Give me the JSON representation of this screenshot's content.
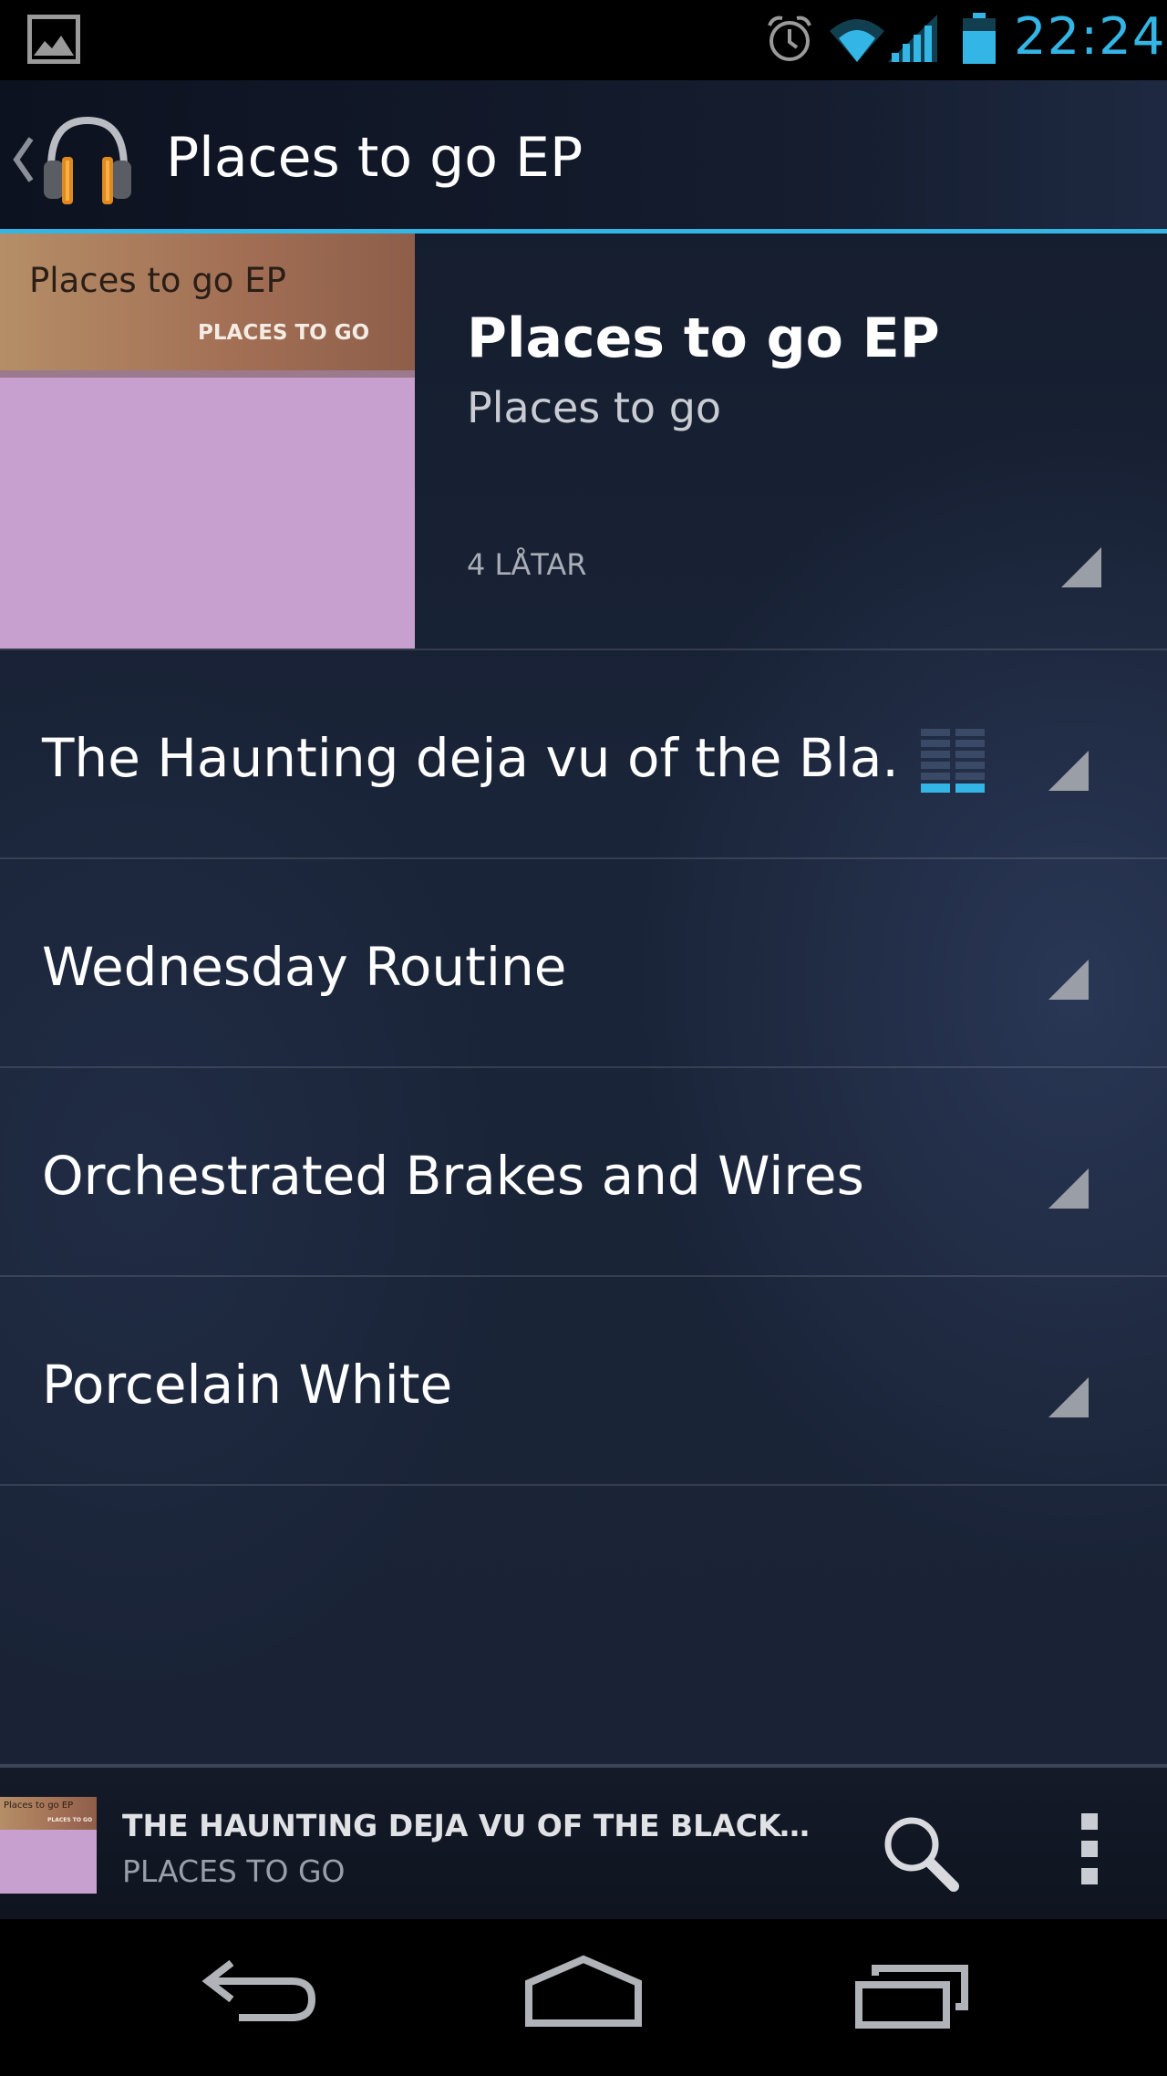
{
  "status_bar": {
    "time": "22:24",
    "icons": [
      "gallery-notification-icon",
      "alarm-icon",
      "wifi-icon",
      "cell-signal-icon",
      "battery-icon"
    ],
    "accent_color": "#33b5e5"
  },
  "action_bar": {
    "title": "Places to go EP",
    "icons": [
      "up-caret-icon",
      "headphones-app-icon"
    ],
    "accent_color": "#33b5e5"
  },
  "album": {
    "title": "Places to go EP",
    "artist": "Places to go",
    "track_count": "4 LÅTAR",
    "art": {
      "title": "Places to go EP",
      "subtitle": "PLACES TO GO",
      "background_color": "#c8a0d0",
      "banner_color": "#a37055"
    }
  },
  "tracks": [
    {
      "title": "The Haunting deja vu of the Bla.",
      "now_playing": true
    },
    {
      "title": "Wednesday Routine",
      "now_playing": false
    },
    {
      "title": "Orchestrated Brakes and Wires",
      "now_playing": false
    },
    {
      "title": "Porcelain White",
      "now_playing": false
    }
  ],
  "now_playing": {
    "title": "THE HAUNTING DEJA VU OF THE BLACKOUTR...",
    "artist": "PLACES TO GO",
    "art_title": "Places to go EP",
    "art_subtitle": "PLACES TO GO",
    "icons": [
      "search-icon",
      "overflow-menu-icon"
    ]
  },
  "nav_bar": {
    "icons": [
      "back-icon",
      "home-icon",
      "recent-apps-icon"
    ]
  }
}
